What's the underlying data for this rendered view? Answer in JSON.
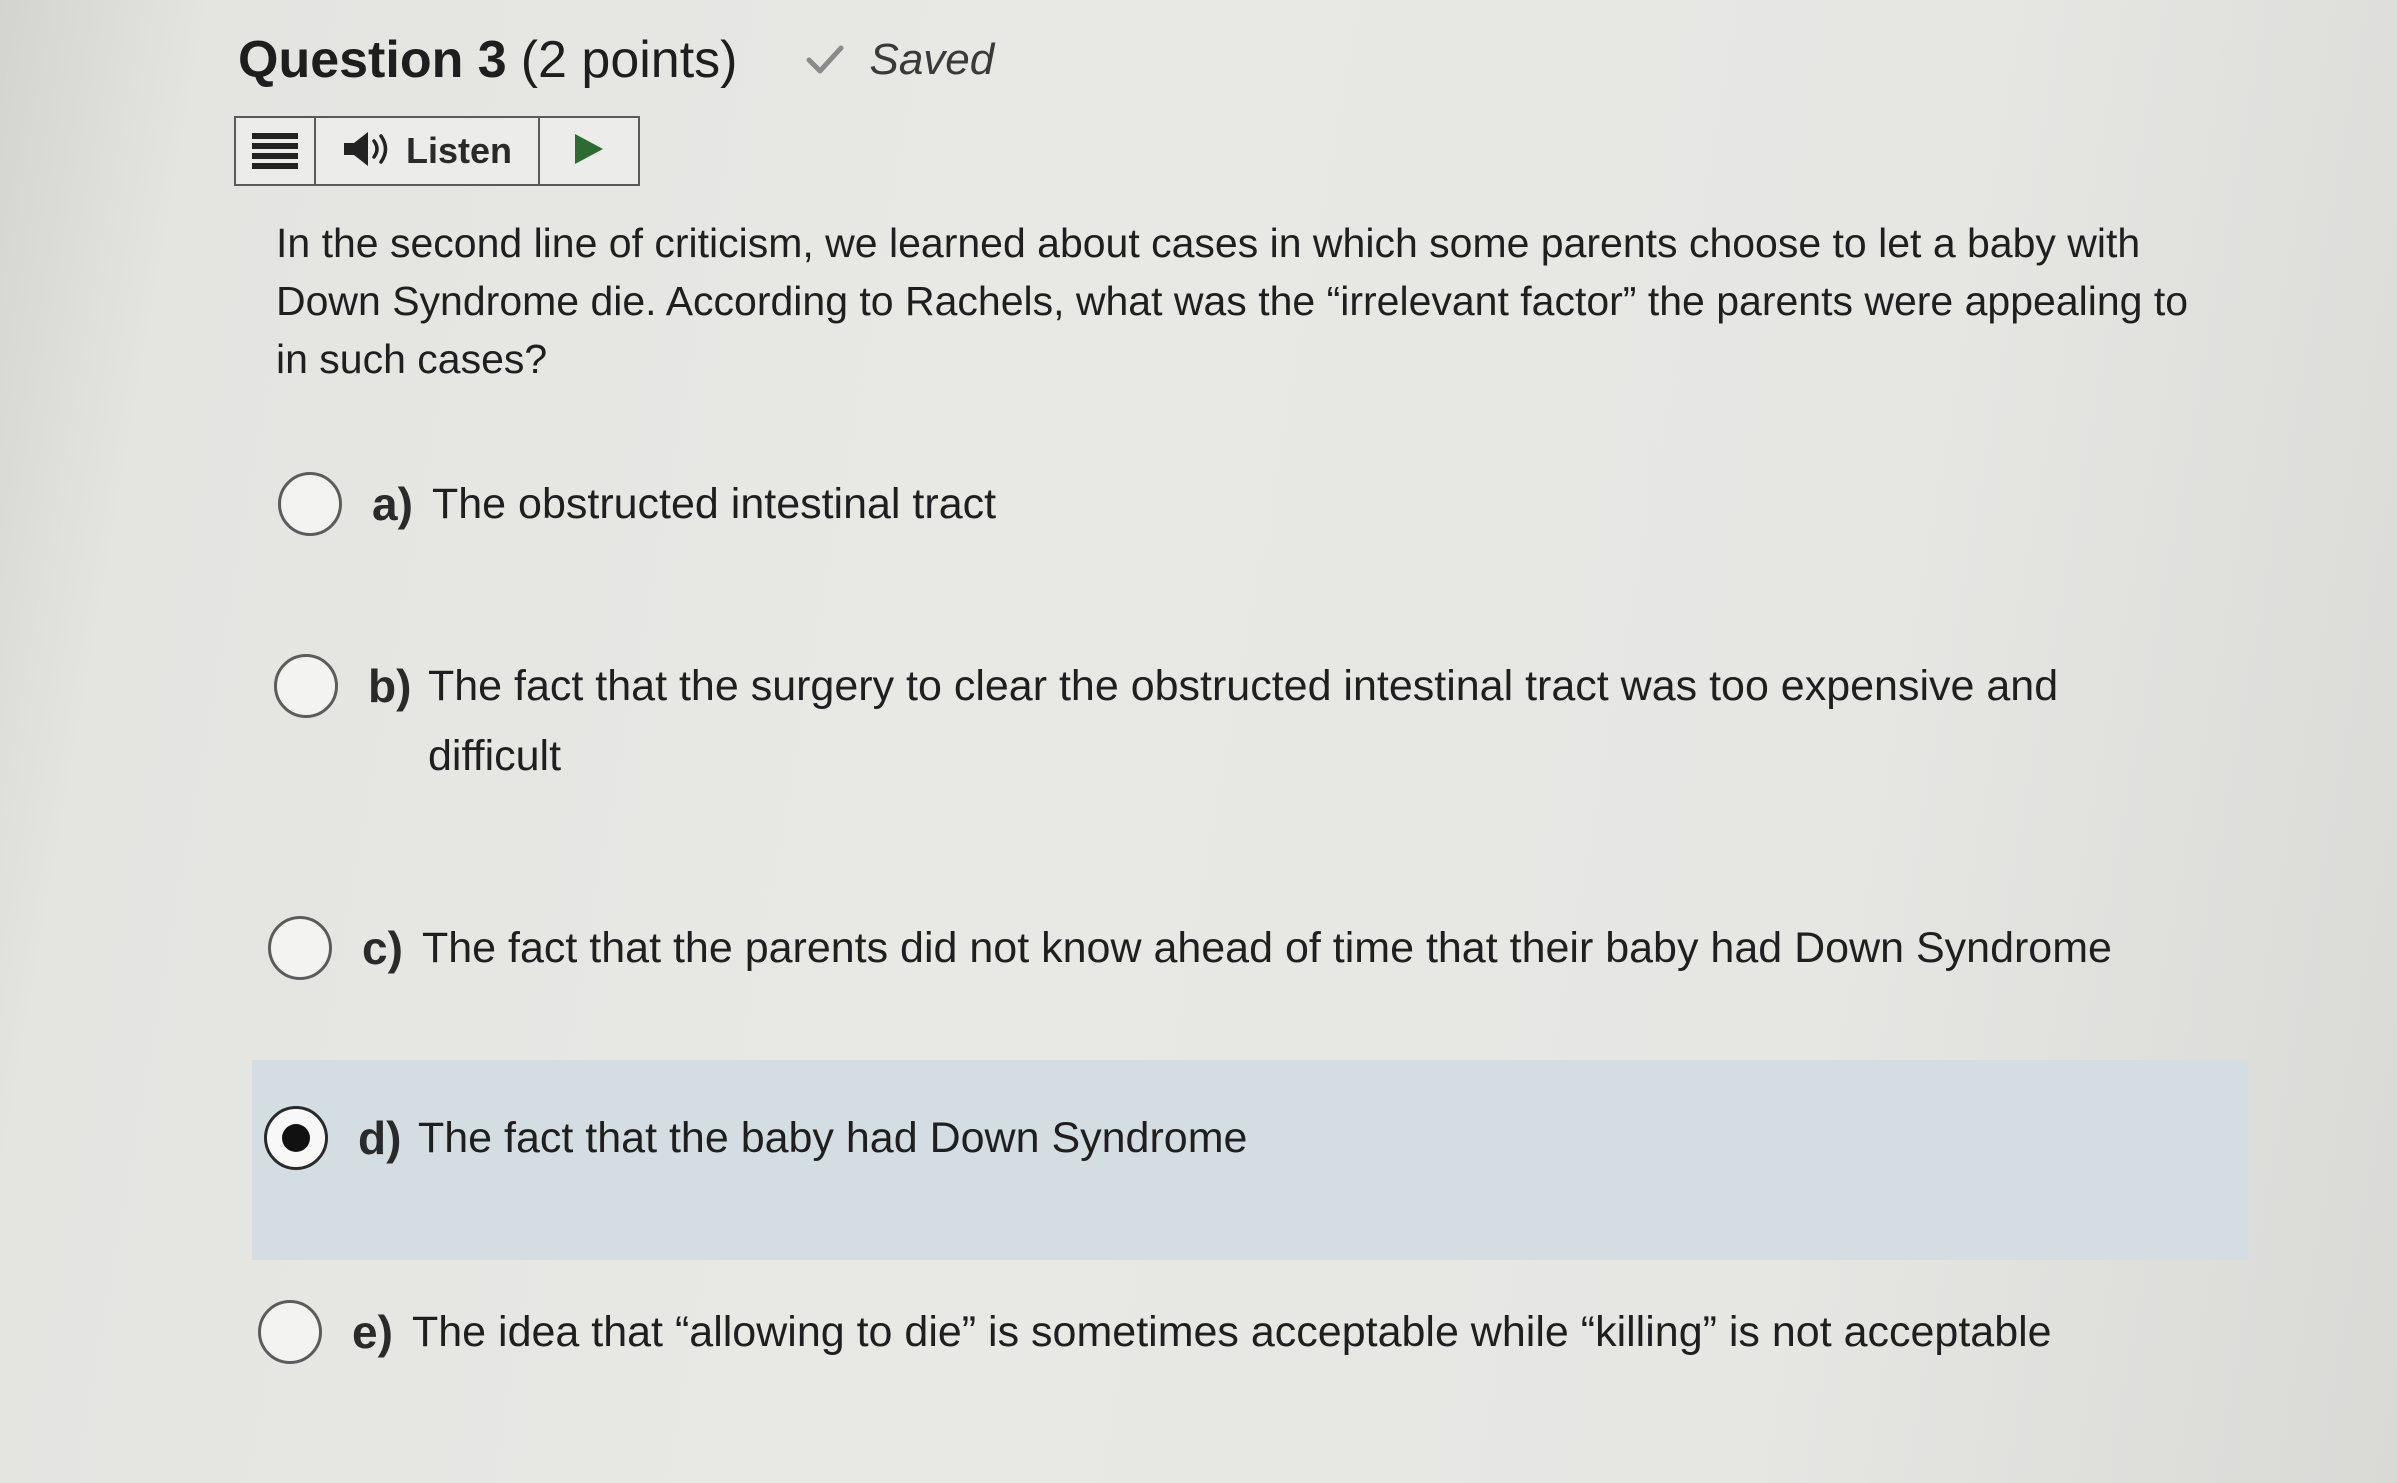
{
  "header": {
    "title": "Question 3",
    "points": "(2 points)",
    "status_icon": "checkmark-icon",
    "status": "Saved"
  },
  "toolbar": {
    "menu_icon": "hamburger-menu-icon",
    "speaker_icon": "speaker-icon",
    "listen_label": "Listen",
    "play_icon": "play-icon"
  },
  "question": {
    "text": "In the second line of criticism, we learned about cases in which some parents choose to let a baby with Down Syndrome die. According to Rachels, what was the “irrelevant factor” the parents were appealing to in such cases?"
  },
  "options": [
    {
      "letter": "a)",
      "text": "The obstructed intestinal tract",
      "selected": false
    },
    {
      "letter": "b)",
      "text": "The fact that the surgery to clear the obstructed intestinal tract was too expensive and difficult",
      "selected": false
    },
    {
      "letter": "c)",
      "text": "The fact that the parents did not know ahead of time that their baby had Down Syndrome",
      "selected": false
    },
    {
      "letter": "d)",
      "text": "The fact that the baby had Down Syndrome",
      "selected": true
    },
    {
      "letter": "e)",
      "text": "The idea that “allowing to die” is sometimes acceptable while “killing” is not acceptable",
      "selected": false
    }
  ],
  "colors": {
    "selected_highlight": "#d4dde2",
    "text": "#1f1f1f",
    "border": "#5a5a5a"
  }
}
